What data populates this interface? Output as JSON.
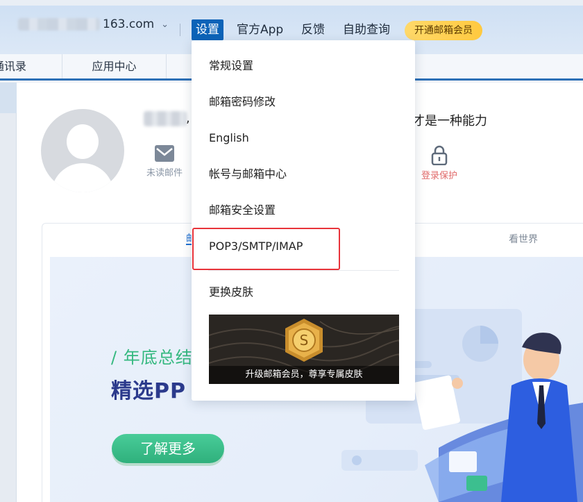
{
  "header": {
    "account_domain": "163.com",
    "nav": [
      "设置",
      "官方App",
      "反馈",
      "自助查询"
    ],
    "vip_button": "开通邮箱会员"
  },
  "tabs": [
    "通讯录",
    "应用中心"
  ],
  "profile": {
    "name_separator": ",",
    "motto": "才是一种能力",
    "stats": [
      {
        "label": "未读邮件",
        "icon": "mail-icon"
      },
      {
        "label": "登录保护",
        "icon": "lock-icon"
      }
    ]
  },
  "section": {
    "tab_active": "邮",
    "tab_right": "看世界"
  },
  "banner": {
    "subtitle": "/ 年底总结",
    "title": "精选PP",
    "button": "了解更多"
  },
  "dropdown": {
    "items": [
      "常规设置",
      "邮箱密码修改",
      "English",
      "帐号与邮箱中心",
      "邮箱安全设置",
      "POP3/SMTP/IMAP",
      "更换皮肤"
    ],
    "skin_caption": "升级邮箱会员，尊享专属皮肤"
  },
  "colors": {
    "header_bg": "#cfe0f4",
    "active_nav": "#0c63b8",
    "vip_gold": "#ffc93f",
    "accent_green": "#34b87f",
    "title_navy": "#2b3a8c",
    "highlight_red": "#e8333a"
  }
}
